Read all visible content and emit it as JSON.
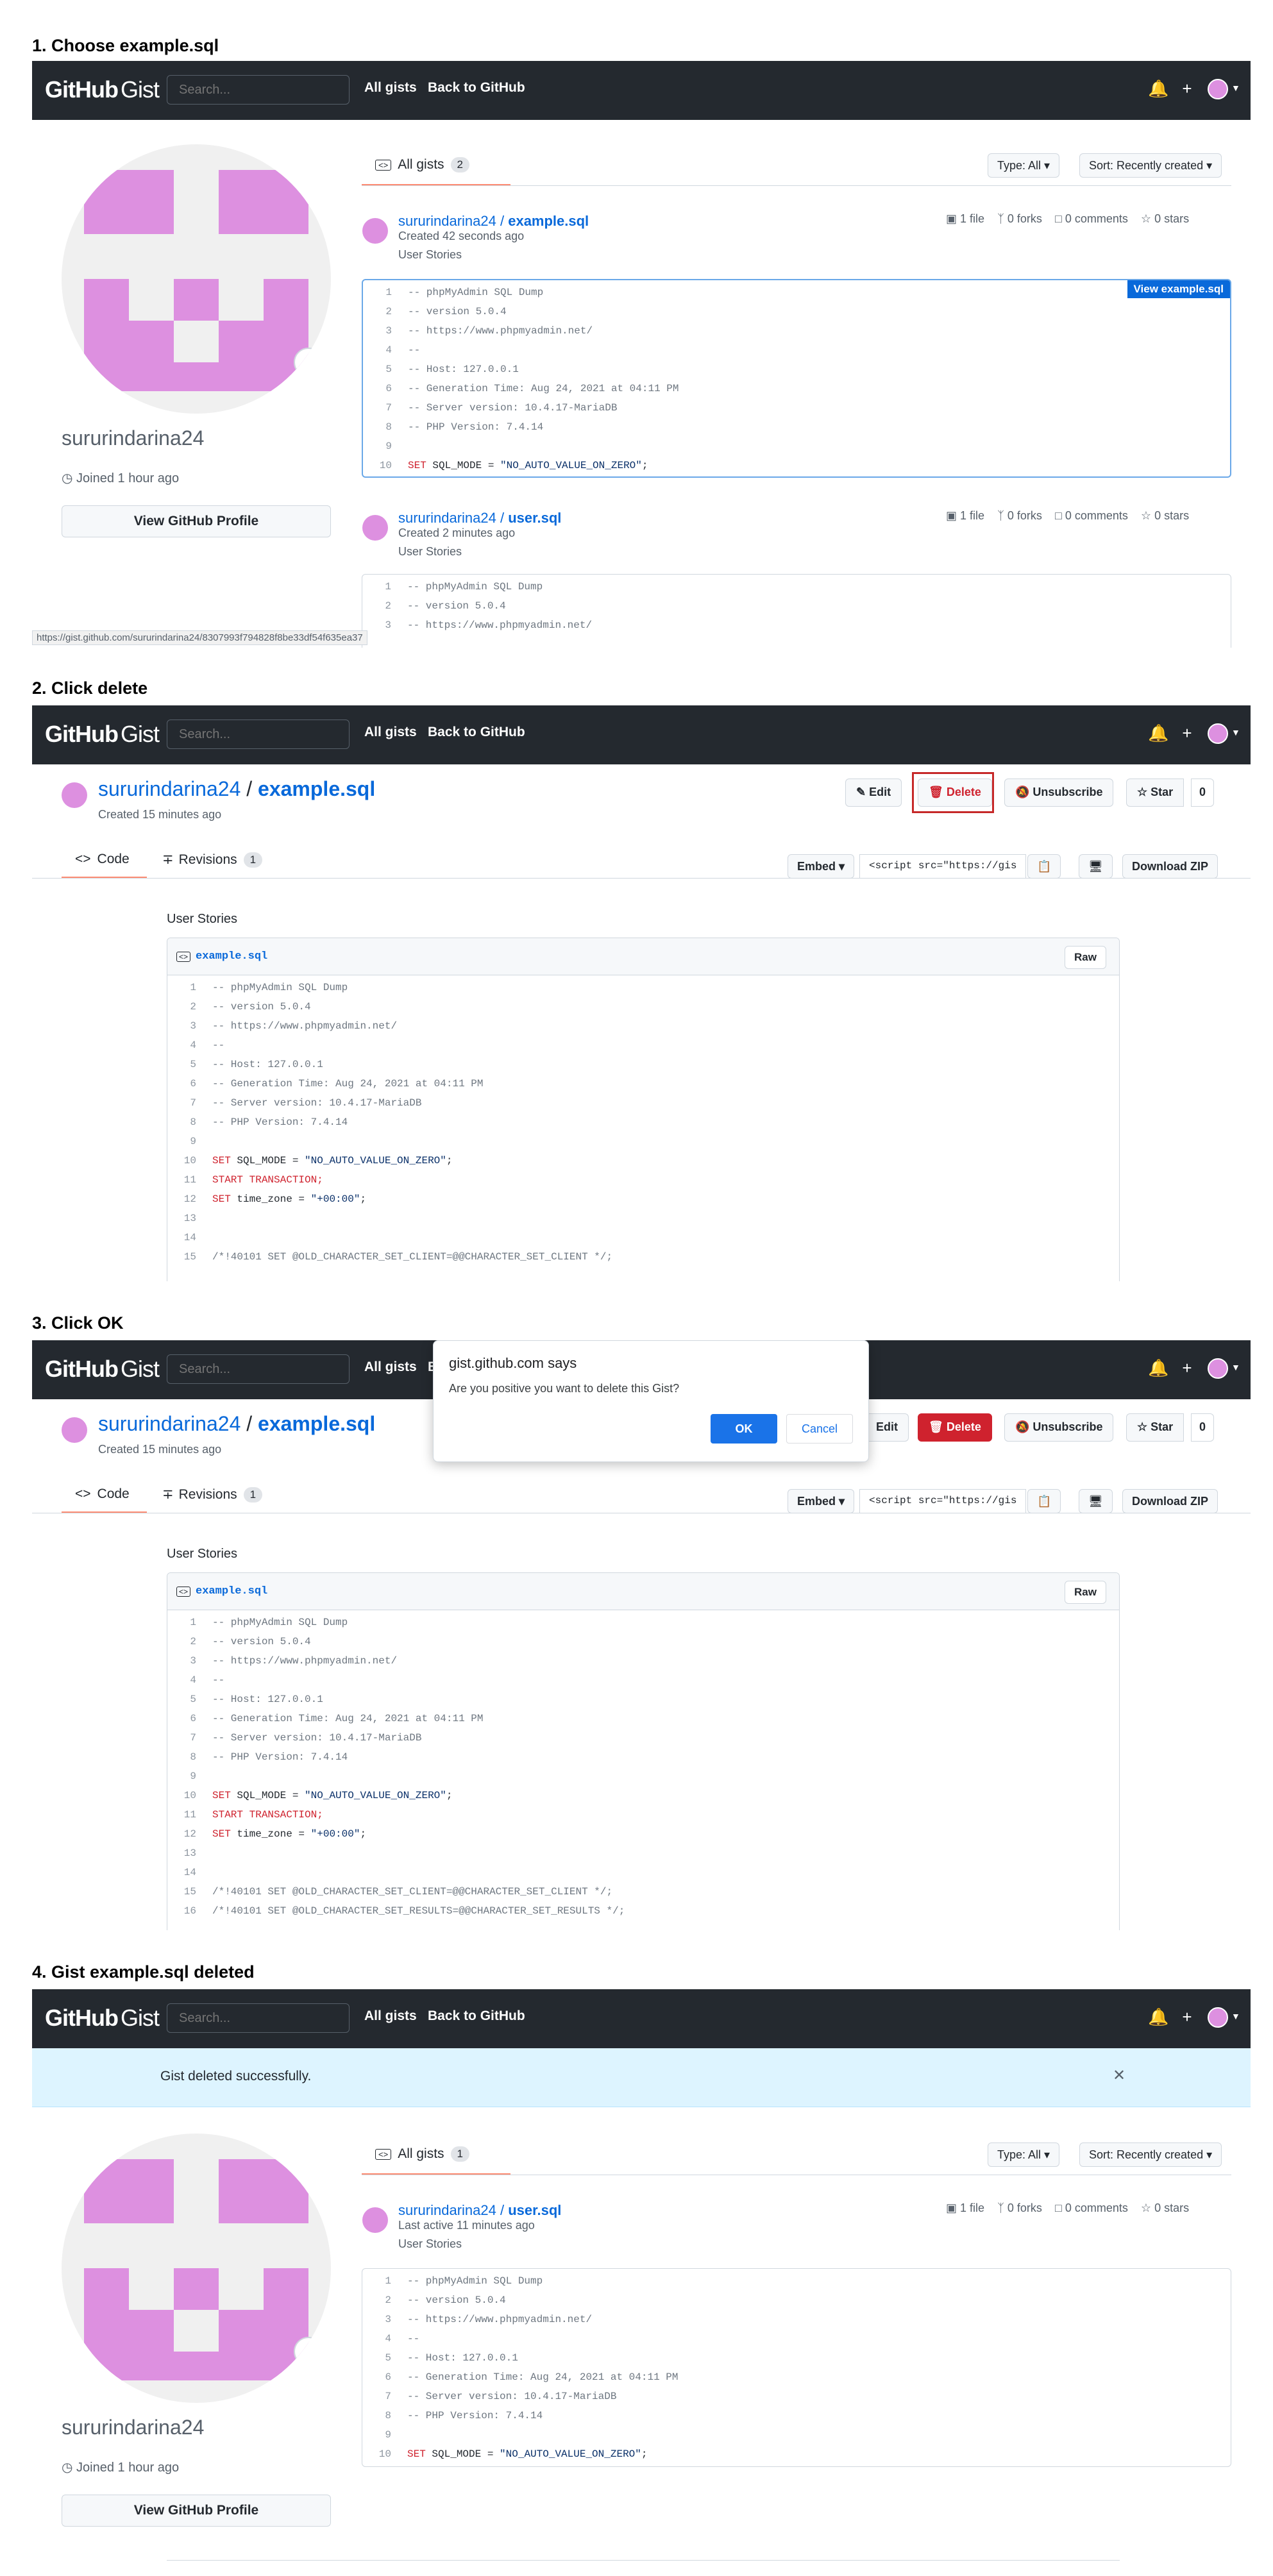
{
  "colors": {
    "accent": "#0969da",
    "header": "#24292f",
    "danger": "#cf222e",
    "avatar": "#dd90e0",
    "flash": "#ddf4ff"
  },
  "steps": [
    "1. Choose example.sql",
    "2.  Click delete",
    "3. Click OK",
    "4. Gist example.sql deleted"
  ],
  "header": {
    "logo_bold": "GitHub",
    "logo_light": "Gist",
    "search_placeholder": "Search...",
    "all_gists": "All gists",
    "back": "Back to GitHub",
    "back_partial": "B",
    "bell_icon": "bell-icon",
    "plus_icon": "plus-icon"
  },
  "profile": {
    "username": "sururindarina24",
    "joined": "Joined 1 hour ago",
    "view_profile": "View GitHub Profile"
  },
  "list1": {
    "tab": "All gists",
    "count": "2",
    "type_filter": "Type: All",
    "sort": "Sort: Recently created",
    "items": [
      {
        "owner": "sururindarina24",
        "sep": " / ",
        "file": "example.sql",
        "created": "Created 42 seconds ago",
        "desc": "User Stories",
        "files": "1 file",
        "forks": "0 forks",
        "comments": "0 comments",
        "stars": "0 stars",
        "view": "View example.sql"
      },
      {
        "owner": "sururindarina24",
        "sep": " / ",
        "file": "user.sql",
        "created": "Created 2 minutes ago",
        "desc": "User Stories",
        "files": "1 file",
        "forks": "0 forks",
        "comments": "0 comments",
        "stars": "0 stars"
      }
    ],
    "status_url": "https://gist.github.com/sururindarina24/8307993f794828f8be33df54f635ea37"
  },
  "code": {
    "lines": [
      {
        "n": "1",
        "t": "-- phpMyAdmin SQL Dump"
      },
      {
        "n": "2",
        "t": "-- version 5.0.4"
      },
      {
        "n": "3",
        "t": "-- https://www.phpmyadmin.net/"
      },
      {
        "n": "4",
        "t": "--"
      },
      {
        "n": "5",
        "t": "-- Host: 127.0.0.1"
      },
      {
        "n": "6",
        "t": "-- Generation Time: Aug 24, 2021 at 04:11 PM"
      },
      {
        "n": "7",
        "t": "-- Server version: 10.4.17-MariaDB"
      },
      {
        "n": "8",
        "t": "-- PHP Version: 7.4.14"
      },
      {
        "n": "9",
        "t": ""
      }
    ],
    "l10_kw": "SET",
    "l10_a": " SQL_MODE = ",
    "l10_s": "\"NO_AUTO_VALUE_ON_ZERO\"",
    "l10_e": ";",
    "l11": "START TRANSACTION;",
    "l12_kw": "SET",
    "l12_a": " time_zone = ",
    "l12_s": "\"+00:00\"",
    "l12_e": ";",
    "l15": "/*!40101 SET @OLD_CHARACTER_SET_CLIENT=@@CHARACTER_SET_CLIENT */;",
    "l16": "/*!40101 SET @OLD_CHARACTER_SET_RESULTS=@@CHARACTER_SET_RESULTS */;"
  },
  "detail": {
    "owner": "sururindarina24",
    "sep": " / ",
    "file": "example.sql",
    "created": "Created 15 minutes ago",
    "edit": "Edit",
    "delete": "Delete",
    "unsubscribe": "Unsubscribe",
    "star": "Star",
    "star_count": "0",
    "tab_code": "Code",
    "tab_revisions": "Revisions",
    "rev_count": "1",
    "embed": "Embed",
    "embed_value": "<script src=\"https://gis",
    "download": "Download ZIP",
    "desc": "User Stories",
    "filename": "example.sql",
    "raw": "Raw"
  },
  "dialog": {
    "title": "gist.github.com says",
    "message": "Are you positive you want to delete this Gist?",
    "ok": "OK",
    "cancel": "Cancel"
  },
  "final": {
    "flash": "Gist deleted successfully.",
    "tab": "All gists",
    "count": "1",
    "type_filter": "Type: All",
    "sort": "Sort: Recently created",
    "item": {
      "owner": "sururindarina24",
      "sep": " / ",
      "file": "user.sql",
      "created": "Last active 11 minutes ago",
      "desc": "User Stories",
      "files": "1 file",
      "forks": "0 forks",
      "comments": "0 comments",
      "stars": "0 stars"
    }
  }
}
